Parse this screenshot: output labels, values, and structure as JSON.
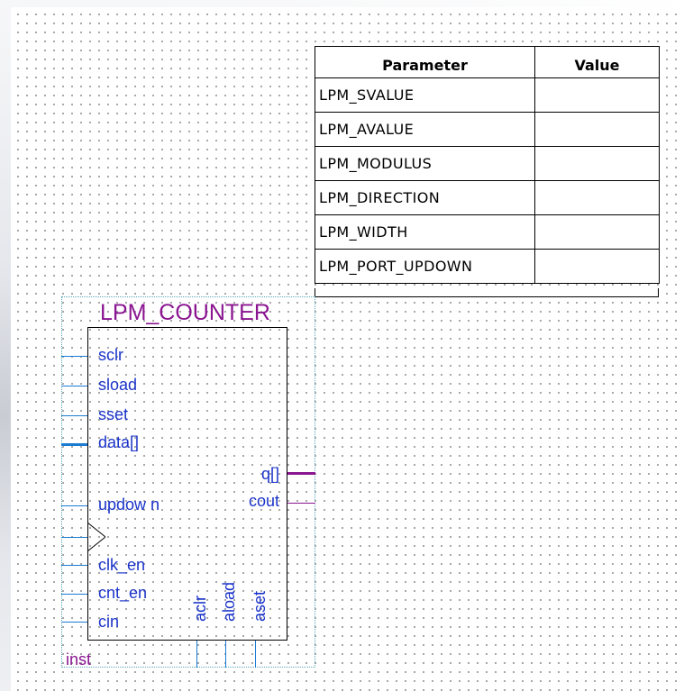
{
  "parameter_table": {
    "header": {
      "parameter": "Parameter",
      "value": "Value"
    },
    "rows": [
      {
        "name": "LPM_SVALUE",
        "value": ""
      },
      {
        "name": "LPM_AVALUE",
        "value": ""
      },
      {
        "name": "LPM_MODULUS",
        "value": ""
      },
      {
        "name": "LPM_DIRECTION",
        "value": ""
      },
      {
        "name": "LPM_WIDTH",
        "value": ""
      },
      {
        "name": "LPM_PORT_UPDOWN",
        "value": ""
      }
    ]
  },
  "symbol": {
    "title": "LPM_COUNTER",
    "instance": "inst",
    "inputs": {
      "sclr": "sclr",
      "sload": "sload",
      "sset": "sset",
      "data": "data[]",
      "updown": "updow n",
      "clk_en": "clk_en",
      "cnt_en": "cnt_en",
      "cin": "cin"
    },
    "outputs": {
      "q": "q[]",
      "cout": "cout"
    },
    "bottom": {
      "aclr": "aclr",
      "aload": "aload",
      "aset": "aset"
    }
  },
  "colors": {
    "pin_label": "#1a33c8",
    "wire": "#1a7bd1",
    "symbol_title": "#8a1590",
    "output_wire": "#8a1590"
  }
}
